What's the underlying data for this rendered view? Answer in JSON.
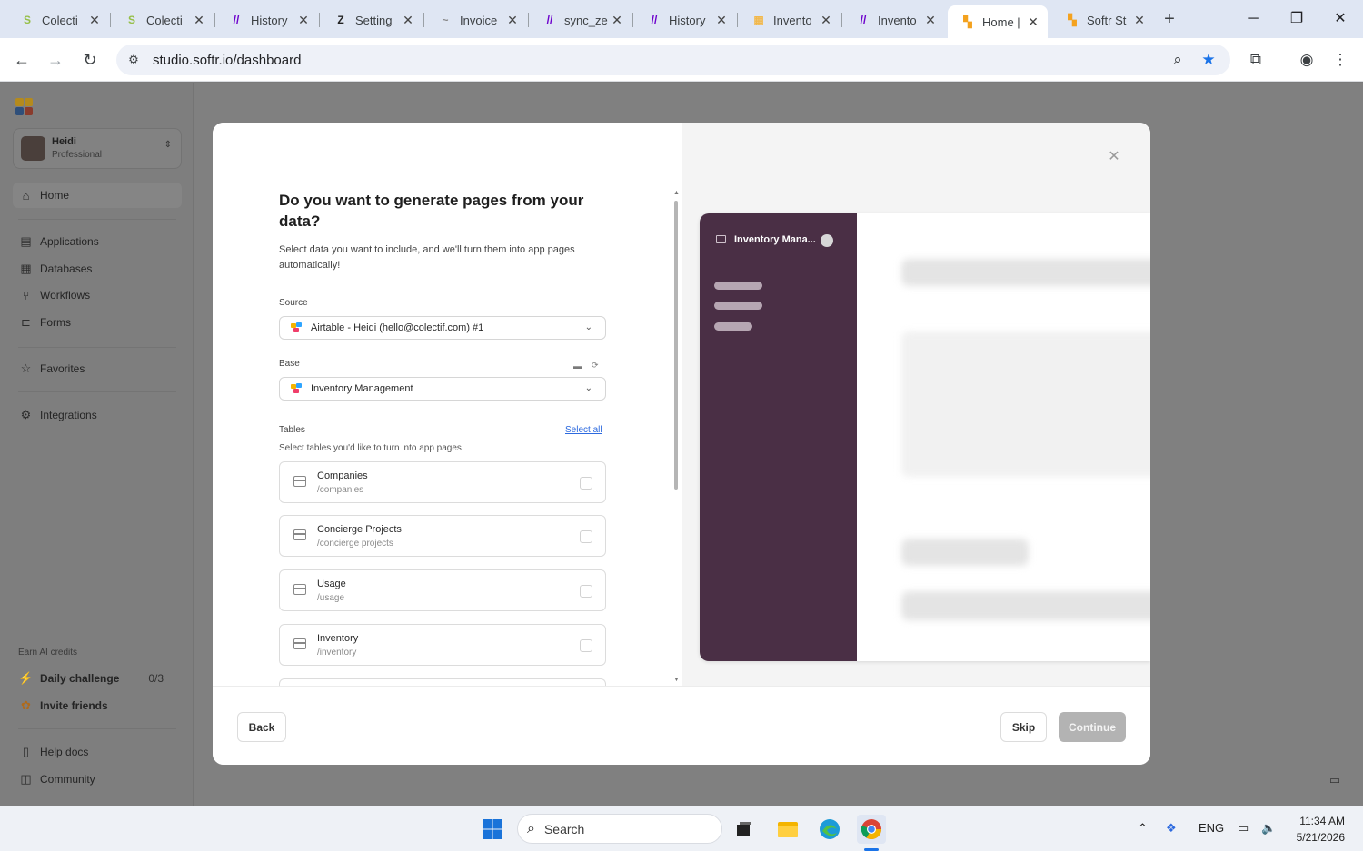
{
  "browser": {
    "tabs": [
      {
        "title": "Colecti",
        "icon": "shopify-icon",
        "color": "#95bf47",
        "glyph": "S"
      },
      {
        "title": "Colecti",
        "icon": "shopify-icon",
        "color": "#95bf47",
        "glyph": "S"
      },
      {
        "title": "History",
        "icon": "make-icon",
        "color": "#6d00cc",
        "glyph": "//"
      },
      {
        "title": "Setting",
        "icon": "zapier-icon",
        "color": "#222222",
        "glyph": "Z"
      },
      {
        "title": "Invoice",
        "icon": "invoice-icon",
        "color": "#888888",
        "glyph": "~"
      },
      {
        "title": "sync_ze",
        "icon": "make-icon",
        "color": "#6d00cc",
        "glyph": "//"
      },
      {
        "title": "History",
        "icon": "make-icon",
        "color": "#6d00cc",
        "glyph": "//"
      },
      {
        "title": "Invento",
        "icon": "airtable-icon",
        "color": "#f2b84b",
        "glyph": "▦"
      },
      {
        "title": "Invento",
        "icon": "make-icon",
        "color": "#6d00cc",
        "glyph": "//"
      },
      {
        "title": "Home |",
        "icon": "softr-icon",
        "color": "#f4a21e",
        "glyph": "▚"
      },
      {
        "title": "Softr St",
        "icon": "softr-icon",
        "color": "#f4a21e",
        "glyph": "▚"
      }
    ],
    "active_tab": 9,
    "url": "studio.softr.io/dashboard"
  },
  "sidebar": {
    "workspace": {
      "name": "Heidi",
      "plan": "Professional"
    },
    "nav": [
      {
        "label": "Home",
        "icon": "home-icon",
        "glyph": "⌂"
      },
      {
        "label": "Applications",
        "icon": "applications-icon",
        "glyph": "▤"
      },
      {
        "label": "Databases",
        "icon": "databases-icon",
        "glyph": "▦"
      },
      {
        "label": "Workflows",
        "icon": "workflows-icon",
        "glyph": "⑂"
      },
      {
        "label": "Forms",
        "icon": "forms-icon",
        "glyph": "⊏"
      },
      {
        "label": "Favorites",
        "icon": "star-icon",
        "glyph": "☆"
      },
      {
        "label": "Integrations",
        "icon": "integrations-icon",
        "glyph": "⚙"
      }
    ],
    "earn_label": "Earn AI credits",
    "daily_challenge": {
      "label": "Daily challenge",
      "count": "0/3"
    },
    "invite": "Invite friends",
    "help_docs": "Help docs",
    "community": "Community"
  },
  "modal": {
    "title": "Do you want to generate pages from your data?",
    "subtitle": "Select data you want to include, and we'll turn them into app pages automatically!",
    "source_label": "Source",
    "source_value": "Airtable - Heidi (hello@colectif.com) #1",
    "base_label": "Base",
    "base_value": "Inventory Management",
    "tables_label": "Tables",
    "select_all": "Select all",
    "tables_hint": "Select tables you'd like to turn into app pages.",
    "tables": [
      {
        "name": "Companies",
        "path": "/companies"
      },
      {
        "name": "Concierge Projects",
        "path": "/concierge projects"
      },
      {
        "name": "Usage",
        "path": "/usage"
      },
      {
        "name": "Inventory",
        "path": "/inventory"
      }
    ],
    "preview_title": "Inventory Mana...",
    "back": "Back",
    "skip": "Skip",
    "continue": "Continue"
  },
  "taskbar": {
    "search_placeholder": "Search",
    "lang": "ENG",
    "time": "11:34 AM",
    "date": "5/21/2026"
  },
  "colors": {
    "brand_purple": "#4a2f45",
    "link_blue": "#2d6adf",
    "continue_disabled": "#b3b3b3"
  }
}
